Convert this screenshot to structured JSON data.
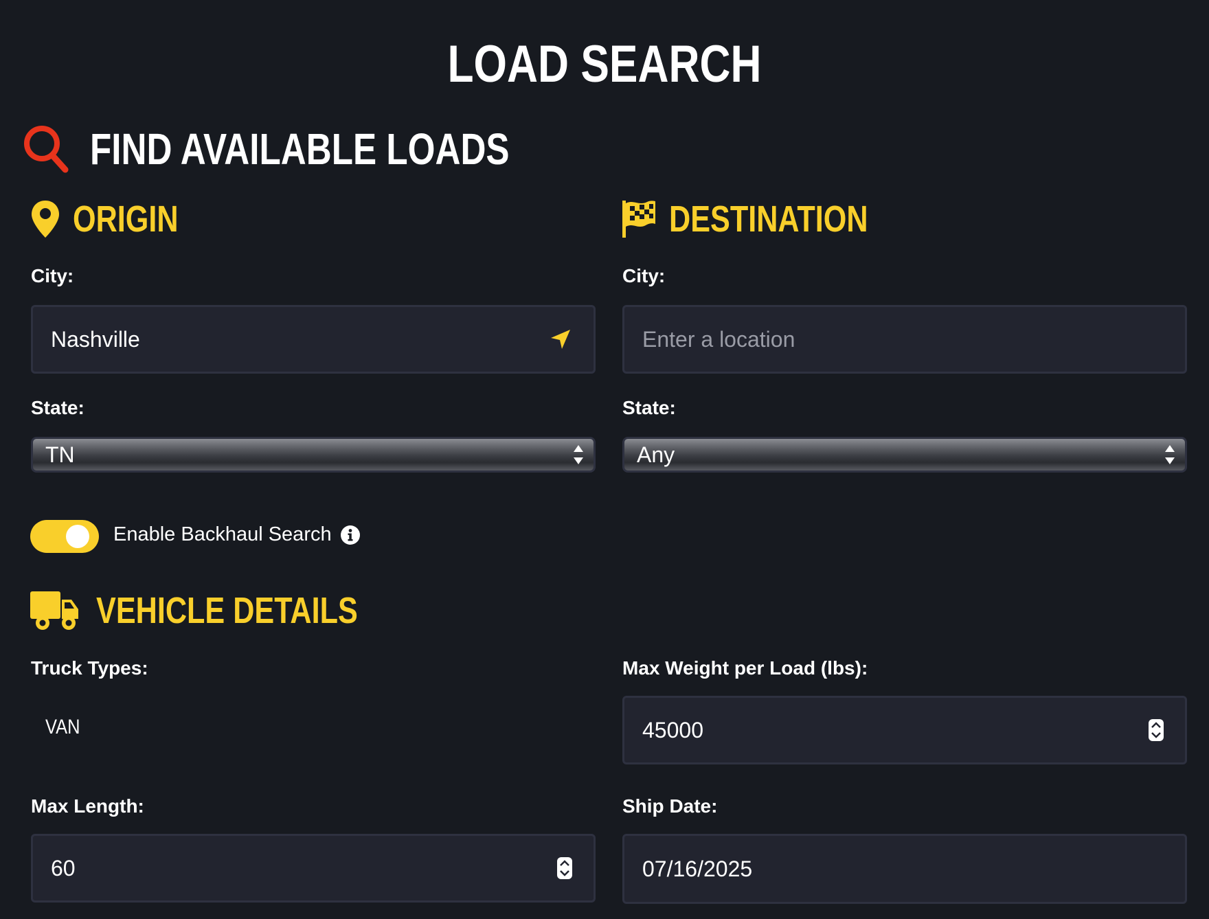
{
  "page": {
    "title": "LOAD SEARCH"
  },
  "find_section": {
    "title": "FIND AVAILABLE LOADS",
    "icon": "search-icon"
  },
  "origin": {
    "title": "ORIGIN",
    "icon": "map-pin-icon",
    "city_label": "City:",
    "city_value": "Nashville",
    "city_icon": "location-arrow-icon",
    "state_label": "State:",
    "state_value": "TN"
  },
  "destination": {
    "title": "DESTINATION",
    "icon": "checkered-flag-icon",
    "city_label": "City:",
    "city_placeholder": "Enter a location",
    "state_label": "State:",
    "state_value": "Any"
  },
  "backhaul": {
    "label": "Enable Backhaul Search",
    "enabled": true,
    "info_icon": "info-icon"
  },
  "vehicle": {
    "title": "VEHICLE DETAILS",
    "icon": "truck-icon",
    "truck_types_label": "Truck Types:",
    "truck_types_value": "VAN",
    "max_weight_label": "Max Weight per Load (lbs):",
    "max_weight_value": "45000",
    "max_length_label": "Max Length:",
    "max_length_value": "60",
    "ship_date_label": "Ship Date:",
    "ship_date_value": "07/16/2025"
  },
  "colors": {
    "background": "#171a20",
    "accent_yellow": "#f9cf2b",
    "search_red": "#e8341c",
    "field_bg": "#22242f"
  }
}
